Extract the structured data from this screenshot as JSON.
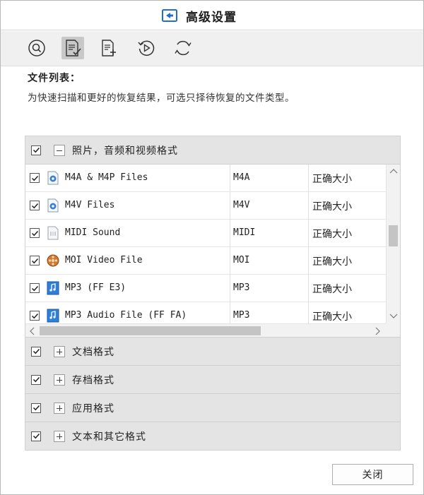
{
  "window": {
    "title": "高级设置",
    "close_label": "关闭"
  },
  "toolbar": {
    "buttons": [
      {
        "icon": "search-circle-icon",
        "active": false
      },
      {
        "icon": "file-list-check-icon",
        "active": true
      },
      {
        "icon": "file-add-icon",
        "active": false
      },
      {
        "icon": "restore-play-icon",
        "active": false
      },
      {
        "icon": "refresh-icon",
        "active": false
      }
    ]
  },
  "file_list": {
    "heading": "文件列表：",
    "description": "为快速扫描和更好的恢复结果，可选只择待恢复的文件类型。"
  },
  "categories": [
    {
      "label": "照片，音频和视频格式",
      "expanded": true,
      "checked": true
    },
    {
      "label": "文档格式",
      "expanded": false,
      "checked": true
    },
    {
      "label": "存档格式",
      "expanded": false,
      "checked": true
    },
    {
      "label": "应用格式",
      "expanded": false,
      "checked": true
    },
    {
      "label": "文本和其它格式",
      "expanded": false,
      "checked": true
    }
  ],
  "files": [
    {
      "name": "M4A & M4P Files",
      "ext": "M4A",
      "size": "正确大小",
      "checked": true,
      "icon": "audio-file-icon"
    },
    {
      "name": "M4V Files",
      "ext": "M4V",
      "size": "正确大小",
      "checked": true,
      "icon": "audio-file-icon"
    },
    {
      "name": "MIDI Sound",
      "ext": "MIDI",
      "size": "正确大小",
      "checked": true,
      "icon": "midi-file-icon"
    },
    {
      "name": "MOI Video File",
      "ext": "MOI",
      "size": "正确大小",
      "checked": true,
      "icon": "video-reel-icon"
    },
    {
      "name": "MP3 (FF E3)",
      "ext": "MP3",
      "size": "正确大小",
      "checked": true,
      "icon": "mp3-file-icon"
    },
    {
      "name": "MP3 Audio File (FF FA)",
      "ext": "MP3",
      "size": "正确大小",
      "checked": true,
      "icon": "mp3-file-icon"
    }
  ],
  "colors": {
    "category_bg": "#e4e4e4",
    "toolbar_bg": "#f0f0f0",
    "title_icon_blue": "#1e6fd0"
  }
}
